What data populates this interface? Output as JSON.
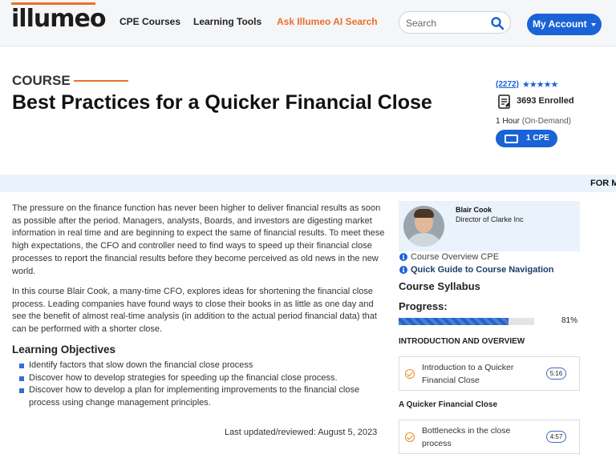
{
  "header": {
    "logo_text": "illumeo",
    "nav": [
      "CPE Courses",
      "Learning Tools",
      "Ask Illumeo AI Search"
    ],
    "search_placeholder": "Search",
    "account_label": "My Account"
  },
  "course": {
    "label": "COURSE",
    "title": "Best Practices for a Quicker Financial Close",
    "rating_count": "(2272)",
    "rating_stars": 4.5,
    "enrolled": "3693 Enrolled",
    "duration": "1 Hour",
    "duration_mode": "(On-Demand)",
    "cpe": "1 CPE"
  },
  "band": {
    "text": "FOR M"
  },
  "description": {
    "para1": "The pressure on the finance function has never been higher to deliver financial results as soon as possible after the period.  Managers, analysts, Boards, and investors are digesting market information in real time and are beginning to expect the same of financial results.  To meet these high expectations, the CFO and controller need to find ways to speed up their financial close processes to report the financial results before they become perceived as old news in the new world.",
    "para2": "In this course Blair Cook, a many-time CFO, explores ideas for shortening the financial close process.  Leading companies have found ways to close their books in as little as one day and see the benefit of almost real-time analysis (in addition to the actual period financial data) that can be performed with a shorter close.",
    "objectives_title": "Learning Objectives",
    "objectives": [
      "Identify factors that slow down the financial close process",
      "Discover how to develop strategies for speeding up the financial close process.",
      "Discover how to develop a plan for implementing improvements to the financial close process using change management principles."
    ],
    "updated": "Last updated/reviewed: August 5, 2023"
  },
  "instructor": {
    "name": "Blair Cook",
    "role": "Director of Clarke Inc"
  },
  "links": {
    "overview": "Course Overview CPE",
    "guide": "Quick Guide to Course Navigation"
  },
  "syllabus": {
    "title": "Course Syllabus",
    "progress_label": "Progress:",
    "progress_value": 81,
    "progress_text": "81%",
    "sections": [
      {
        "title": "INTRODUCTION AND OVERVIEW",
        "lesson": "Introduction to a Quicker Financial Close",
        "time": "5:16"
      },
      {
        "title": "A Quicker Financial Close",
        "lesson": "Bottlenecks in the close process",
        "time": "4:57"
      }
    ]
  },
  "colors": {
    "accent_orange": "#e8702a",
    "brand_blue": "#1a63d6",
    "band_blue": "#eaf2fb"
  }
}
